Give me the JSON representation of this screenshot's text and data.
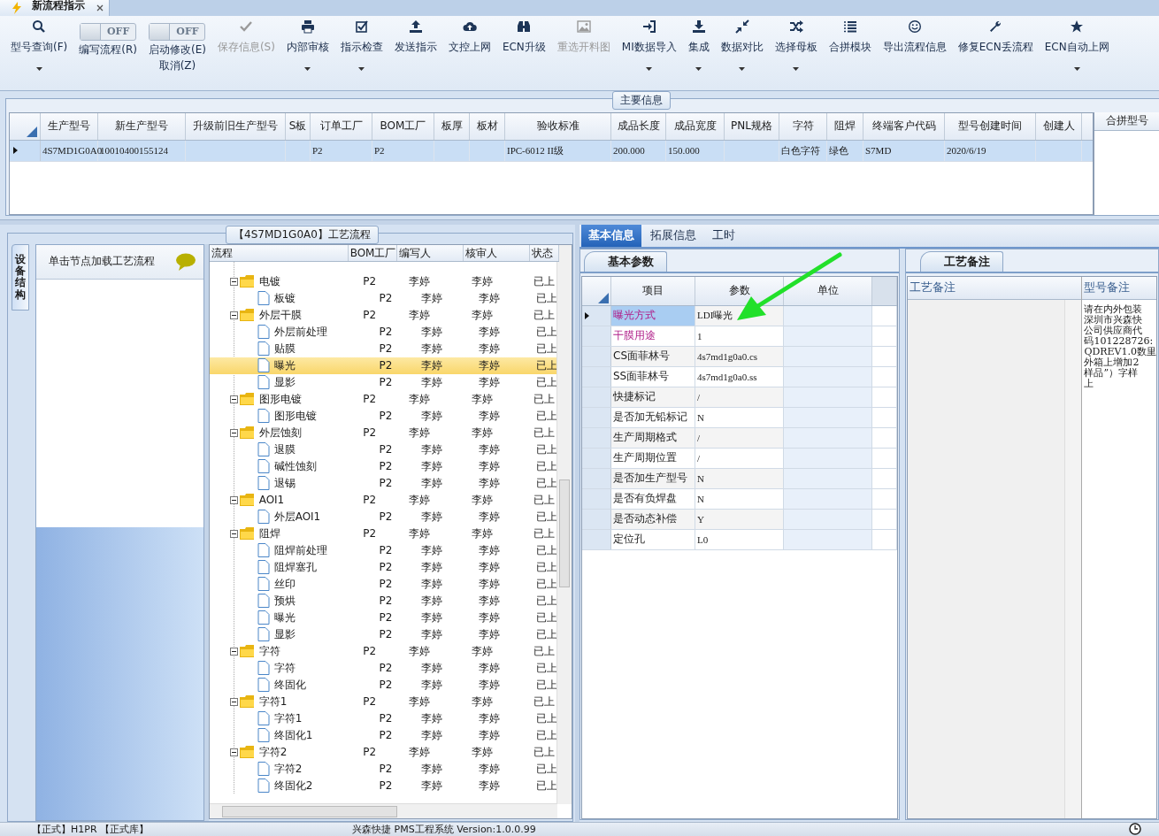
{
  "document_tab": {
    "title": "新流程指示",
    "selected": true
  },
  "toolbar": [
    {
      "kind": "button",
      "label": "型号查询(F)",
      "disabled": false,
      "dropdown": true
    },
    {
      "kind": "toggle",
      "label": "编写流程(R)",
      "on": false,
      "state_text": "OFF"
    },
    {
      "kind": "toggle",
      "label": "启动修改(E)",
      "sublabel": "取消(Z)",
      "on": false,
      "state_text": "OFF"
    },
    {
      "kind": "button",
      "label": "保存信息(S)",
      "disabled": true,
      "dropdown": false
    },
    {
      "kind": "button",
      "label": "内部审核",
      "disabled": false,
      "dropdown": true
    },
    {
      "kind": "button",
      "label": "指示检查",
      "disabled": false,
      "dropdown": true
    },
    {
      "kind": "button",
      "label": "发送指示",
      "disabled": false,
      "dropdown": false
    },
    {
      "kind": "button",
      "label": "文控上网",
      "disabled": false,
      "dropdown": false
    },
    {
      "kind": "button",
      "label": "ECN升级",
      "disabled": false,
      "dropdown": false
    },
    {
      "kind": "button",
      "label": "重选开料图",
      "disabled": true,
      "dropdown": false
    },
    {
      "kind": "button",
      "label": "MI数据导入",
      "disabled": false,
      "dropdown": true
    },
    {
      "kind": "button",
      "label": "集成",
      "disabled": false,
      "dropdown": true
    },
    {
      "kind": "button",
      "label": "数据对比",
      "disabled": false,
      "dropdown": true
    },
    {
      "kind": "button",
      "label": "选择母板",
      "disabled": false,
      "dropdown": true
    },
    {
      "kind": "button",
      "label": "合拼模块",
      "disabled": false,
      "dropdown": false
    },
    {
      "kind": "button",
      "label": "导出流程信息",
      "disabled": false,
      "dropdown": false
    },
    {
      "kind": "button",
      "label": "修复ECN丢流程",
      "disabled": false,
      "dropdown": false
    },
    {
      "kind": "button",
      "label": "ECN自动上网",
      "disabled": false,
      "dropdown": true
    }
  ],
  "main_info": {
    "title": "主要信息",
    "columns": [
      "生产型号",
      "新生产型号",
      "升级前旧生产型号",
      "S板",
      "订单工厂",
      "BOM工厂",
      "板厚",
      "板材",
      "验收标准",
      "成品长度",
      "成品宽度",
      "PNL规格",
      "字符",
      "阻焊",
      "终端客户代码",
      "型号创建时间",
      "创建人"
    ],
    "rows": [
      {
        "selected": true,
        "cells": {
          "0": "4S7MD1G0A0",
          "1": "10010400155124",
          "4": "P2",
          "5": "P2",
          "8": "IPC-6012 II级",
          "9": "200.000",
          "10": "150.000",
          "12": "白色字符",
          "13": "绿色",
          "14": "S7MD",
          "15": "2020/6/19"
        }
      }
    ],
    "side_column": "合拼型号"
  },
  "flow_panel": {
    "title": "【4S7MD1G0A0】工艺流程",
    "side_tab": "设备结构",
    "hint": "单击节点加载工艺流程",
    "columns": [
      "流程",
      "BOM工厂",
      "编写人",
      "核审人",
      "状态"
    ],
    "nodes": [
      {
        "kind": "folder",
        "label": "电镀",
        "bom": "P2",
        "author": "李婷",
        "reviewer": "李婷",
        "status": "已上",
        "selected": false,
        "expanded": true,
        "children": [
          {
            "kind": "leaf",
            "label": "板镀",
            "bom": "P2",
            "author": "李婷",
            "reviewer": "李婷",
            "status": "已上",
            "selected": false
          }
        ]
      },
      {
        "kind": "folder",
        "label": "外层干膜",
        "bom": "P2",
        "author": "李婷",
        "reviewer": "李婷",
        "status": "已上",
        "selected": false,
        "expanded": true,
        "children": [
          {
            "kind": "leaf",
            "label": "外层前处理",
            "bom": "P2",
            "author": "李婷",
            "reviewer": "李婷",
            "status": "已上",
            "selected": false
          },
          {
            "kind": "leaf",
            "label": "贴膜",
            "bom": "P2",
            "author": "李婷",
            "reviewer": "李婷",
            "status": "已上",
            "selected": false
          },
          {
            "kind": "leaf",
            "label": "曝光",
            "bom": "P2",
            "author": "李婷",
            "reviewer": "李婷",
            "status": "已上",
            "selected": true
          },
          {
            "kind": "leaf",
            "label": "显影",
            "bom": "P2",
            "author": "李婷",
            "reviewer": "李婷",
            "status": "已上",
            "selected": false
          }
        ]
      },
      {
        "kind": "folder",
        "label": "图形电镀",
        "bom": "P2",
        "author": "李婷",
        "reviewer": "李婷",
        "status": "已上",
        "selected": false,
        "expanded": true,
        "children": [
          {
            "kind": "leaf",
            "label": "图形电镀",
            "bom": "P2",
            "author": "李婷",
            "reviewer": "李婷",
            "status": "已上",
            "selected": false
          }
        ]
      },
      {
        "kind": "folder",
        "label": "外层蚀刻",
        "bom": "P2",
        "author": "李婷",
        "reviewer": "李婷",
        "status": "已上",
        "selected": false,
        "expanded": true,
        "children": [
          {
            "kind": "leaf",
            "label": "退膜",
            "bom": "P2",
            "author": "李婷",
            "reviewer": "李婷",
            "status": "已上",
            "selected": false
          },
          {
            "kind": "leaf",
            "label": "碱性蚀刻",
            "bom": "P2",
            "author": "李婷",
            "reviewer": "李婷",
            "status": "已上",
            "selected": false
          },
          {
            "kind": "leaf",
            "label": "退锡",
            "bom": "P2",
            "author": "李婷",
            "reviewer": "李婷",
            "status": "已上",
            "selected": false
          }
        ]
      },
      {
        "kind": "folder",
        "label": "AOI1",
        "bom": "P2",
        "author": "李婷",
        "reviewer": "李婷",
        "status": "已上",
        "selected": false,
        "expanded": true,
        "children": [
          {
            "kind": "leaf",
            "label": "外层AOI1",
            "bom": "P2",
            "author": "李婷",
            "reviewer": "李婷",
            "status": "已上",
            "selected": false
          }
        ]
      },
      {
        "kind": "folder",
        "label": "阻焊",
        "bom": "P2",
        "author": "李婷",
        "reviewer": "李婷",
        "status": "已上",
        "selected": false,
        "expanded": true,
        "children": [
          {
            "kind": "leaf",
            "label": "阻焊前处理",
            "bom": "P2",
            "author": "李婷",
            "reviewer": "李婷",
            "status": "已上",
            "selected": false
          },
          {
            "kind": "leaf",
            "label": "阻焊塞孔",
            "bom": "P2",
            "author": "李婷",
            "reviewer": "李婷",
            "status": "已上",
            "selected": false
          },
          {
            "kind": "leaf",
            "label": "丝印",
            "bom": "P2",
            "author": "李婷",
            "reviewer": "李婷",
            "status": "已上",
            "selected": false
          },
          {
            "kind": "leaf",
            "label": "预烘",
            "bom": "P2",
            "author": "李婷",
            "reviewer": "李婷",
            "status": "已上",
            "selected": false
          },
          {
            "kind": "leaf",
            "label": "曝光",
            "bom": "P2",
            "author": "李婷",
            "reviewer": "李婷",
            "status": "已上",
            "selected": false
          },
          {
            "kind": "leaf",
            "label": "显影",
            "bom": "P2",
            "author": "李婷",
            "reviewer": "李婷",
            "status": "已上",
            "selected": false
          }
        ]
      },
      {
        "kind": "folder",
        "label": "字符",
        "bom": "P2",
        "author": "李婷",
        "reviewer": "李婷",
        "status": "已上",
        "selected": false,
        "expanded": true,
        "children": [
          {
            "kind": "leaf",
            "label": "字符",
            "bom": "P2",
            "author": "李婷",
            "reviewer": "李婷",
            "status": "已上",
            "selected": false
          },
          {
            "kind": "leaf",
            "label": "终固化",
            "bom": "P2",
            "author": "李婷",
            "reviewer": "李婷",
            "status": "已上",
            "selected": false
          }
        ]
      },
      {
        "kind": "folder",
        "label": "字符1",
        "bom": "P2",
        "author": "李婷",
        "reviewer": "李婷",
        "status": "已上",
        "selected": false,
        "expanded": true,
        "children": [
          {
            "kind": "leaf",
            "label": "字符1",
            "bom": "P2",
            "author": "李婷",
            "reviewer": "李婷",
            "status": "已上",
            "selected": false
          },
          {
            "kind": "leaf",
            "label": "终固化1",
            "bom": "P2",
            "author": "李婷",
            "reviewer": "李婷",
            "status": "已上",
            "selected": false
          }
        ]
      },
      {
        "kind": "folder",
        "label": "字符2",
        "bom": "P2",
        "author": "李婷",
        "reviewer": "李婷",
        "status": "已上",
        "selected": false,
        "expanded": true,
        "children": [
          {
            "kind": "leaf",
            "label": "字符2",
            "bom": "P2",
            "author": "李婷",
            "reviewer": "李婷",
            "status": "已上",
            "selected": false
          },
          {
            "kind": "leaf",
            "label": "终固化2",
            "bom": "P2",
            "author": "李婷",
            "reviewer": "李婷",
            "status": "已上",
            "selected": false
          }
        ]
      }
    ]
  },
  "detail_tabs": [
    {
      "label": "基本信息",
      "selected": true
    },
    {
      "label": "拓展信息",
      "selected": false
    },
    {
      "label": "工时",
      "selected": false
    }
  ],
  "params": {
    "tab": "基本参数",
    "columns": [
      "项目",
      "参数",
      "单位"
    ],
    "rows": [
      {
        "item": "曝光方式",
        "value": "LDI曝光",
        "required": true,
        "selected": true
      },
      {
        "item": "干膜用途",
        "value": "1",
        "required": true,
        "selected": false
      },
      {
        "item": "CS面菲林号",
        "value": "4s7md1g0a0.cs",
        "required": false,
        "selected": false
      },
      {
        "item": "SS面菲林号",
        "value": "4s7md1g0a0.ss",
        "required": false,
        "selected": false
      },
      {
        "item": "快捷标记",
        "value": "/",
        "required": false,
        "selected": false
      },
      {
        "item": "是否加无铅标记",
        "value": "N",
        "required": false,
        "selected": false
      },
      {
        "item": "生产周期格式",
        "value": "/",
        "required": false,
        "selected": false
      },
      {
        "item": "生产周期位置",
        "value": "/",
        "required": false,
        "selected": false
      },
      {
        "item": "是否加生产型号",
        "value": "N",
        "required": false,
        "selected": false
      },
      {
        "item": "是否有负焊盘",
        "value": "N",
        "required": false,
        "selected": false
      },
      {
        "item": "是否动态补偿",
        "value": "Y",
        "required": false,
        "selected": false
      },
      {
        "item": "定位孔",
        "value": "L0",
        "required": false,
        "selected": false
      }
    ]
  },
  "remarks": {
    "tab": "工艺备注",
    "columns": [
      "工艺备注",
      "型号备注"
    ],
    "model_note_lines": [
      "请在内外包装",
      "深圳市兴森快",
      "公司供应商代",
      "码101228726:",
      "QDREV1.0数里",
      "外箱上增加2",
      "样品”）字样",
      "上"
    ]
  },
  "status_bar": {
    "left": "【正式】H1PR 【正式库】",
    "center": "兴森快捷 PMS工程系统 Version:1.0.0.99"
  }
}
